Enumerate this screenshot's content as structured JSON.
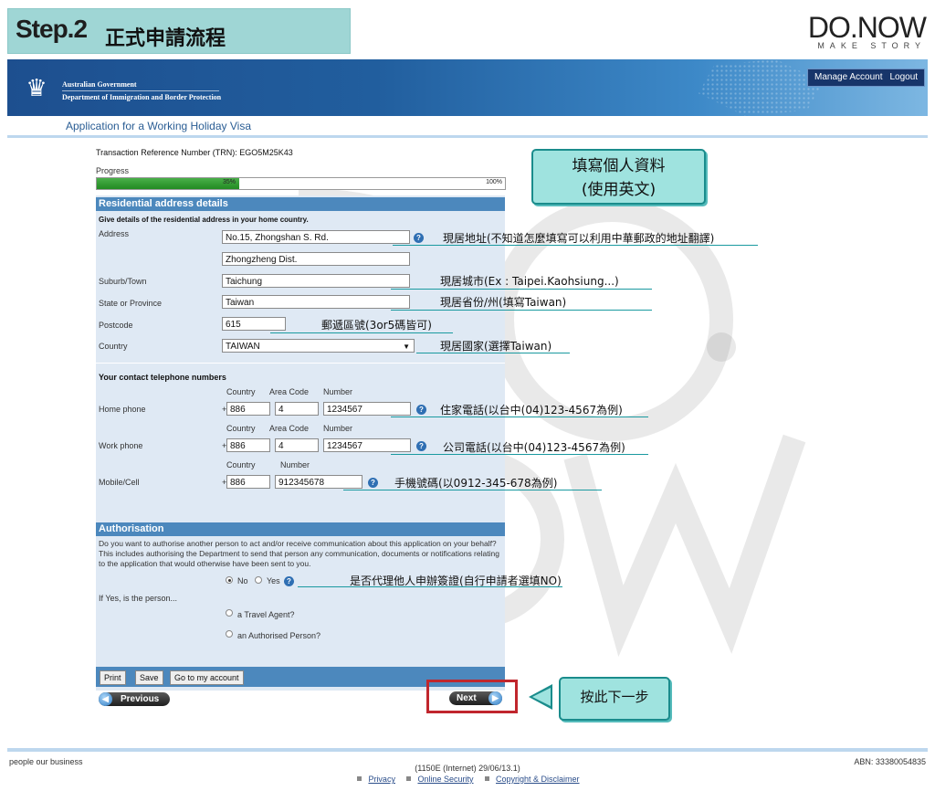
{
  "step": {
    "badge": "Step.2",
    "title": "正式申請流程"
  },
  "brand": {
    "name": "DO.NOW",
    "tagline": "MAKE STORY"
  },
  "gov": {
    "line1": "Australian Government",
    "line2": "Department of Immigration and Border Protection",
    "manage": "Manage Account",
    "logout": "Logout"
  },
  "app_title": "Application for a Working Holiday Visa",
  "trn": "Transaction Reference Number (TRN): EGO5M25K43",
  "progress": {
    "label": "Progress",
    "value": 0.35,
    "value_text": "35%",
    "max_text": "100%"
  },
  "residential": {
    "title": "Residential address details",
    "desc": "Give details of the residential address in your home country.",
    "address_label": "Address",
    "address1": "No.15, Zhongshan S. Rd.",
    "address2": "Zhongzheng Dist.",
    "suburb_label": "Suburb/Town",
    "suburb": "Taichung",
    "state_label": "State or Province",
    "state": "Taiwan",
    "postcode_label": "Postcode",
    "postcode": "615",
    "country_label": "Country",
    "country": "TAIWAN"
  },
  "contact": {
    "title": "Your contact telephone numbers",
    "col_country": "Country",
    "col_area": "Area Code",
    "col_number": "Number",
    "home_label": "Home phone",
    "home": {
      "country": "886",
      "area": "4",
      "number": "1234567"
    },
    "work_label": "Work phone",
    "work": {
      "country": "886",
      "area": "4",
      "number": "1234567"
    },
    "mobile_label": "Mobile/Cell",
    "mobile": {
      "country": "886",
      "number": "912345678"
    },
    "plus": "+"
  },
  "auth": {
    "title": "Authorisation",
    "question": "Do you want to authorise another person to act and/or receive communication about this application on your behalf? This includes authorising the Department to send that person any communication, documents or notifications relating to the application that would otherwise have been sent to you.",
    "no": "No",
    "yes": "Yes",
    "if_yes": "If Yes, is the person...",
    "opt1": "a Travel Agent?",
    "opt2": "an Authorised Person?"
  },
  "buttons": {
    "print": "Print",
    "save": "Save",
    "goto": "Go to my account",
    "previous": "Previous",
    "next": "Next"
  },
  "annotations": {
    "callout_main_1": "填寫個人資料",
    "callout_main_2": "(使用英文)",
    "address": "現居地址(不知道怎麼填寫可以利用中華郵政的地址翻譯)",
    "city": "現居城市(Ex : Taipei.Kaohsiung...)",
    "state": "現居省份/州(填寫Taiwan)",
    "postcode": "郵遞區號(3or5碼皆可)",
    "country": "現居國家(選擇Taiwan)",
    "home": "住家電話(以台中(04)123-4567為例)",
    "work": "公司電話(以台中(04)123-4567為例)",
    "mobile": "手機號碼(以0912-345-678為例)",
    "auth": "是否代理他人申辦簽證(自行申請者選填NO)",
    "next": "按此下一步"
  },
  "footer": {
    "left": "people our business",
    "center": "(1150E (Internet) 29/06/13.1)",
    "abn": "ABN: 33380054835",
    "links": [
      "Privacy",
      "Online Security",
      "Copyright & Disclaimer"
    ]
  },
  "colors": {
    "gov_blue": "#1d4f8f",
    "section_blue": "#4c88bd",
    "callout": "#9fe3df",
    "highlight_red": "#c0262d",
    "progress_green": "#2a9a2a"
  }
}
